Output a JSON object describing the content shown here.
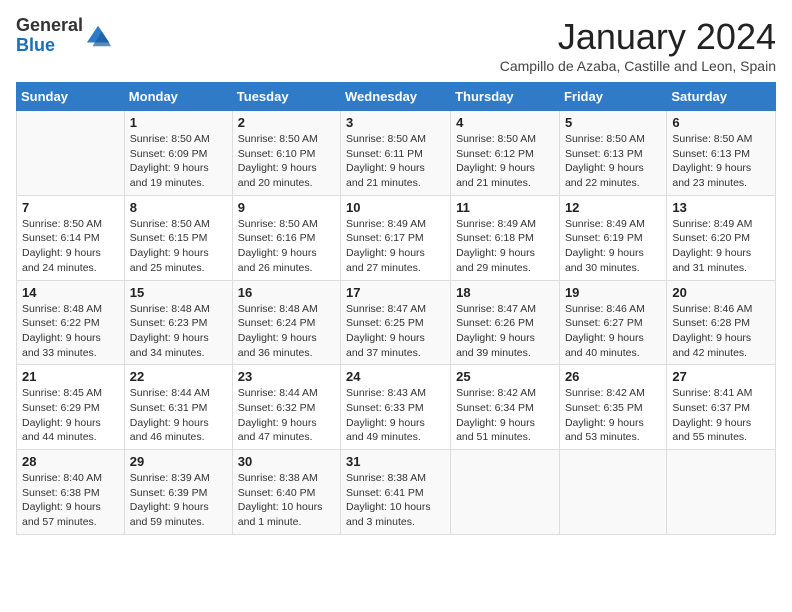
{
  "logo": {
    "text_general": "General",
    "text_blue": "Blue"
  },
  "title": "January 2024",
  "location": "Campillo de Azaba, Castille and Leon, Spain",
  "weekdays": [
    "Sunday",
    "Monday",
    "Tuesday",
    "Wednesday",
    "Thursday",
    "Friday",
    "Saturday"
  ],
  "weeks": [
    [
      {
        "day": "",
        "info": ""
      },
      {
        "day": "1",
        "info": "Sunrise: 8:50 AM\nSunset: 6:09 PM\nDaylight: 9 hours\nand 19 minutes."
      },
      {
        "day": "2",
        "info": "Sunrise: 8:50 AM\nSunset: 6:10 PM\nDaylight: 9 hours\nand 20 minutes."
      },
      {
        "day": "3",
        "info": "Sunrise: 8:50 AM\nSunset: 6:11 PM\nDaylight: 9 hours\nand 21 minutes."
      },
      {
        "day": "4",
        "info": "Sunrise: 8:50 AM\nSunset: 6:12 PM\nDaylight: 9 hours\nand 21 minutes."
      },
      {
        "day": "5",
        "info": "Sunrise: 8:50 AM\nSunset: 6:13 PM\nDaylight: 9 hours\nand 22 minutes."
      },
      {
        "day": "6",
        "info": "Sunrise: 8:50 AM\nSunset: 6:13 PM\nDaylight: 9 hours\nand 23 minutes."
      }
    ],
    [
      {
        "day": "7",
        "info": "Sunrise: 8:50 AM\nSunset: 6:14 PM\nDaylight: 9 hours\nand 24 minutes."
      },
      {
        "day": "8",
        "info": "Sunrise: 8:50 AM\nSunset: 6:15 PM\nDaylight: 9 hours\nand 25 minutes."
      },
      {
        "day": "9",
        "info": "Sunrise: 8:50 AM\nSunset: 6:16 PM\nDaylight: 9 hours\nand 26 minutes."
      },
      {
        "day": "10",
        "info": "Sunrise: 8:49 AM\nSunset: 6:17 PM\nDaylight: 9 hours\nand 27 minutes."
      },
      {
        "day": "11",
        "info": "Sunrise: 8:49 AM\nSunset: 6:18 PM\nDaylight: 9 hours\nand 29 minutes."
      },
      {
        "day": "12",
        "info": "Sunrise: 8:49 AM\nSunset: 6:19 PM\nDaylight: 9 hours\nand 30 minutes."
      },
      {
        "day": "13",
        "info": "Sunrise: 8:49 AM\nSunset: 6:20 PM\nDaylight: 9 hours\nand 31 minutes."
      }
    ],
    [
      {
        "day": "14",
        "info": "Sunrise: 8:48 AM\nSunset: 6:22 PM\nDaylight: 9 hours\nand 33 minutes."
      },
      {
        "day": "15",
        "info": "Sunrise: 8:48 AM\nSunset: 6:23 PM\nDaylight: 9 hours\nand 34 minutes."
      },
      {
        "day": "16",
        "info": "Sunrise: 8:48 AM\nSunset: 6:24 PM\nDaylight: 9 hours\nand 36 minutes."
      },
      {
        "day": "17",
        "info": "Sunrise: 8:47 AM\nSunset: 6:25 PM\nDaylight: 9 hours\nand 37 minutes."
      },
      {
        "day": "18",
        "info": "Sunrise: 8:47 AM\nSunset: 6:26 PM\nDaylight: 9 hours\nand 39 minutes."
      },
      {
        "day": "19",
        "info": "Sunrise: 8:46 AM\nSunset: 6:27 PM\nDaylight: 9 hours\nand 40 minutes."
      },
      {
        "day": "20",
        "info": "Sunrise: 8:46 AM\nSunset: 6:28 PM\nDaylight: 9 hours\nand 42 minutes."
      }
    ],
    [
      {
        "day": "21",
        "info": "Sunrise: 8:45 AM\nSunset: 6:29 PM\nDaylight: 9 hours\nand 44 minutes."
      },
      {
        "day": "22",
        "info": "Sunrise: 8:44 AM\nSunset: 6:31 PM\nDaylight: 9 hours\nand 46 minutes."
      },
      {
        "day": "23",
        "info": "Sunrise: 8:44 AM\nSunset: 6:32 PM\nDaylight: 9 hours\nand 47 minutes."
      },
      {
        "day": "24",
        "info": "Sunrise: 8:43 AM\nSunset: 6:33 PM\nDaylight: 9 hours\nand 49 minutes."
      },
      {
        "day": "25",
        "info": "Sunrise: 8:42 AM\nSunset: 6:34 PM\nDaylight: 9 hours\nand 51 minutes."
      },
      {
        "day": "26",
        "info": "Sunrise: 8:42 AM\nSunset: 6:35 PM\nDaylight: 9 hours\nand 53 minutes."
      },
      {
        "day": "27",
        "info": "Sunrise: 8:41 AM\nSunset: 6:37 PM\nDaylight: 9 hours\nand 55 minutes."
      }
    ],
    [
      {
        "day": "28",
        "info": "Sunrise: 8:40 AM\nSunset: 6:38 PM\nDaylight: 9 hours\nand 57 minutes."
      },
      {
        "day": "29",
        "info": "Sunrise: 8:39 AM\nSunset: 6:39 PM\nDaylight: 9 hours\nand 59 minutes."
      },
      {
        "day": "30",
        "info": "Sunrise: 8:38 AM\nSunset: 6:40 PM\nDaylight: 10 hours\nand 1 minute."
      },
      {
        "day": "31",
        "info": "Sunrise: 8:38 AM\nSunset: 6:41 PM\nDaylight: 10 hours\nand 3 minutes."
      },
      {
        "day": "",
        "info": ""
      },
      {
        "day": "",
        "info": ""
      },
      {
        "day": "",
        "info": ""
      }
    ]
  ]
}
